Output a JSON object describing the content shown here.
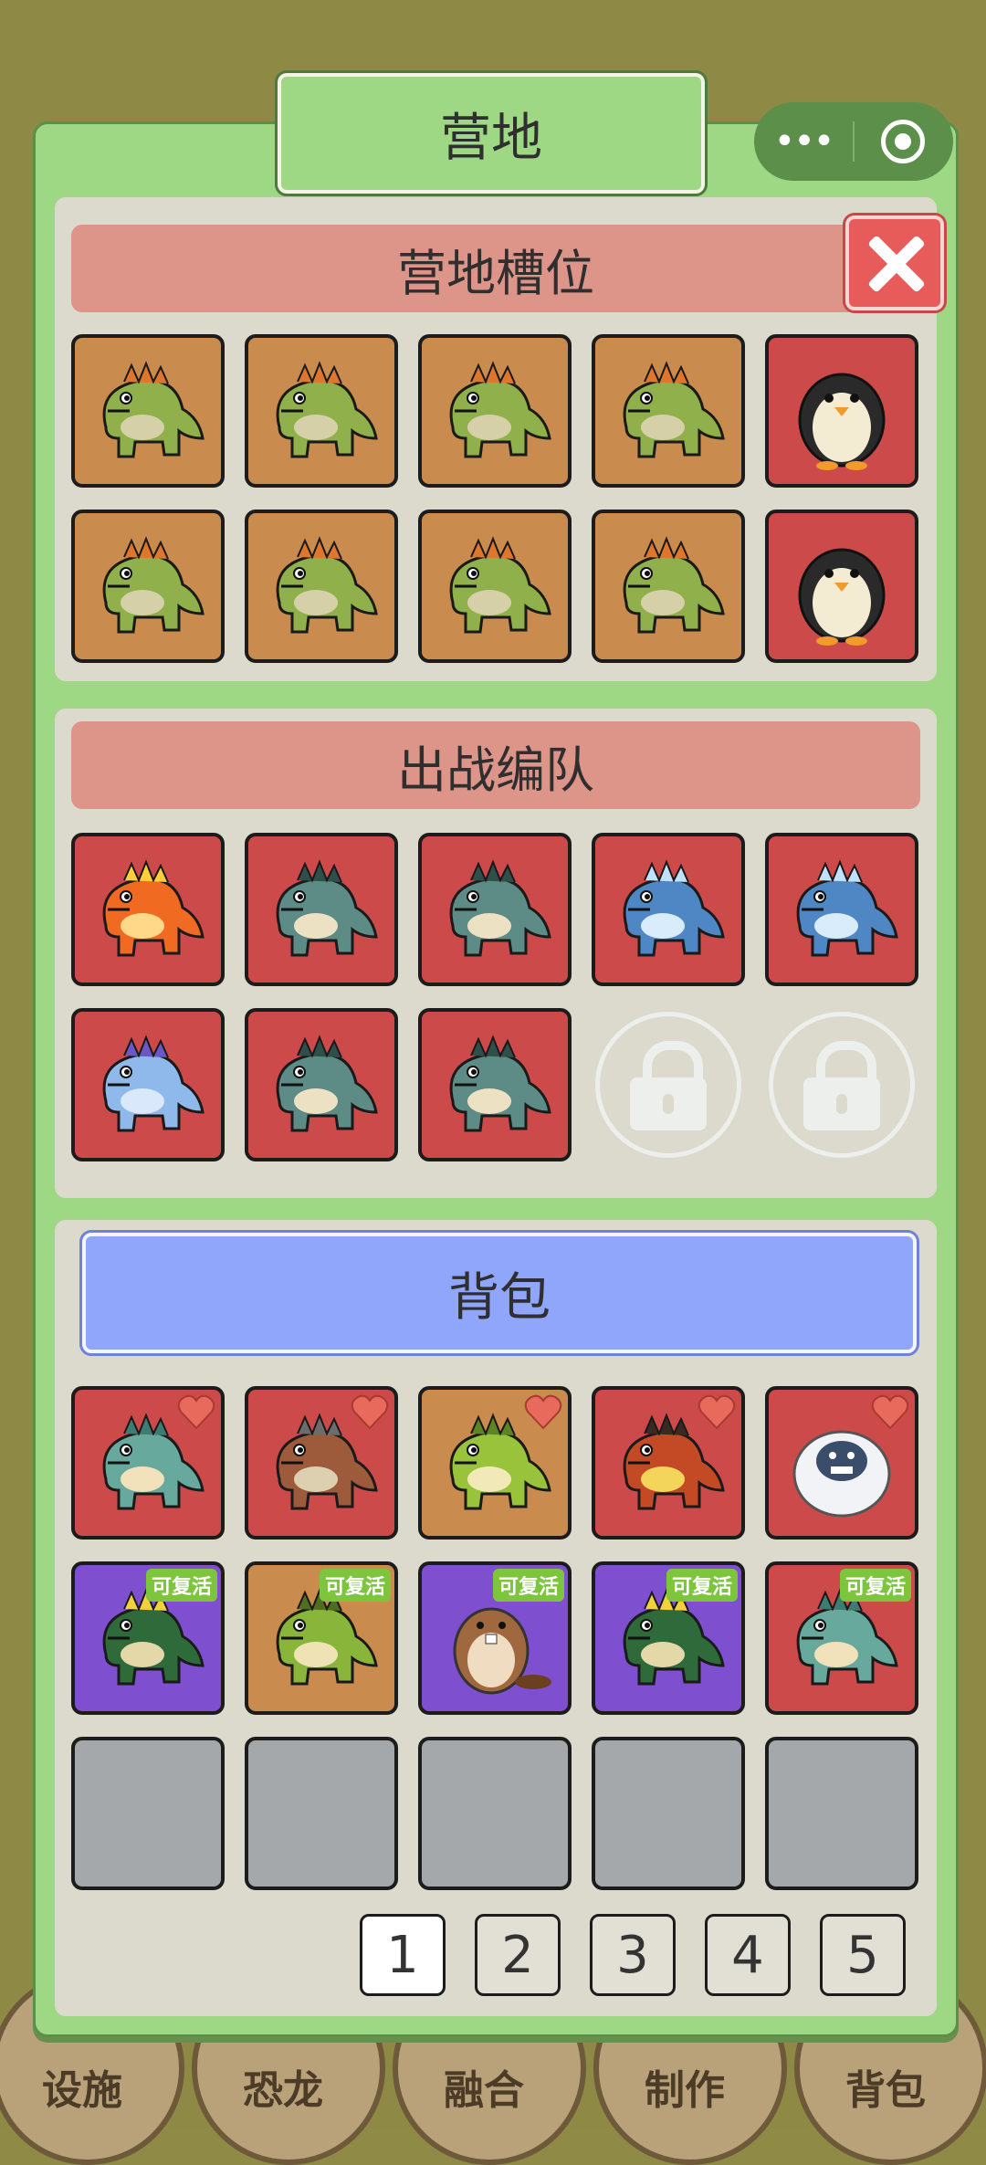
{
  "title": "营地",
  "sections": {
    "camp_slots": "营地槽位",
    "battle_team": "出战编队",
    "backpack": "背包"
  },
  "revive_label": "可复活",
  "camp_slots": [
    {
      "bg": "orange",
      "creature": "stegosaurus"
    },
    {
      "bg": "orange",
      "creature": "stegosaurus"
    },
    {
      "bg": "orange",
      "creature": "stegosaurus"
    },
    {
      "bg": "orange",
      "creature": "stegosaurus"
    },
    {
      "bg": "red",
      "creature": "penguin"
    },
    {
      "bg": "orange",
      "creature": "stegosaurus"
    },
    {
      "bg": "orange",
      "creature": "stegosaurus"
    },
    {
      "bg": "orange",
      "creature": "stegosaurus"
    },
    {
      "bg": "orange",
      "creature": "stegosaurus"
    },
    {
      "bg": "red",
      "creature": "penguin"
    }
  ],
  "team_slots": [
    {
      "bg": "red",
      "creature": "fire-dragon"
    },
    {
      "bg": "red",
      "creature": "t-rex-teal"
    },
    {
      "bg": "red",
      "creature": "t-rex-teal"
    },
    {
      "bg": "red",
      "creature": "ice-ankylosaur"
    },
    {
      "bg": "red",
      "creature": "ice-ankylosaur"
    },
    {
      "bg": "red",
      "creature": "ice-dragon"
    },
    {
      "bg": "red",
      "creature": "t-rex-teal"
    },
    {
      "bg": "red",
      "creature": "t-rex-teal"
    },
    {
      "bg": "locked",
      "creature": "lock"
    },
    {
      "bg": "locked",
      "creature": "lock"
    }
  ],
  "bag_slots": [
    {
      "bg": "red",
      "creature": "baby-dino",
      "heart": true
    },
    {
      "bg": "red",
      "creature": "mech-t-rex",
      "heart": true
    },
    {
      "bg": "orange",
      "creature": "green-t-rex",
      "heart": true
    },
    {
      "bg": "red",
      "creature": "lava-t-rex",
      "heart": true
    },
    {
      "bg": "red",
      "creature": "yeti",
      "heart": true
    },
    {
      "bg": "purple",
      "creature": "raptor-yellow-eye",
      "revive": true
    },
    {
      "bg": "orange",
      "creature": "green-raptor",
      "revive": true
    },
    {
      "bg": "purple",
      "creature": "beaver",
      "revive": true
    },
    {
      "bg": "purple",
      "creature": "raptor-yellow-eye",
      "revive": true
    },
    {
      "bg": "red",
      "creature": "baby-dino",
      "revive": true
    },
    {
      "bg": "empty"
    },
    {
      "bg": "empty"
    },
    {
      "bg": "empty"
    },
    {
      "bg": "empty"
    },
    {
      "bg": "empty"
    }
  ],
  "pages": [
    "1",
    "2",
    "3",
    "4",
    "5"
  ],
  "active_page": "1",
  "background_nav": [
    "设施",
    "恐龙",
    "融合",
    "制作",
    "背包"
  ],
  "colors": {
    "orange": "#c98b4e",
    "red": "#cd4a4b",
    "purple": "#7e4fcf",
    "empty": "#a5a8aa"
  }
}
